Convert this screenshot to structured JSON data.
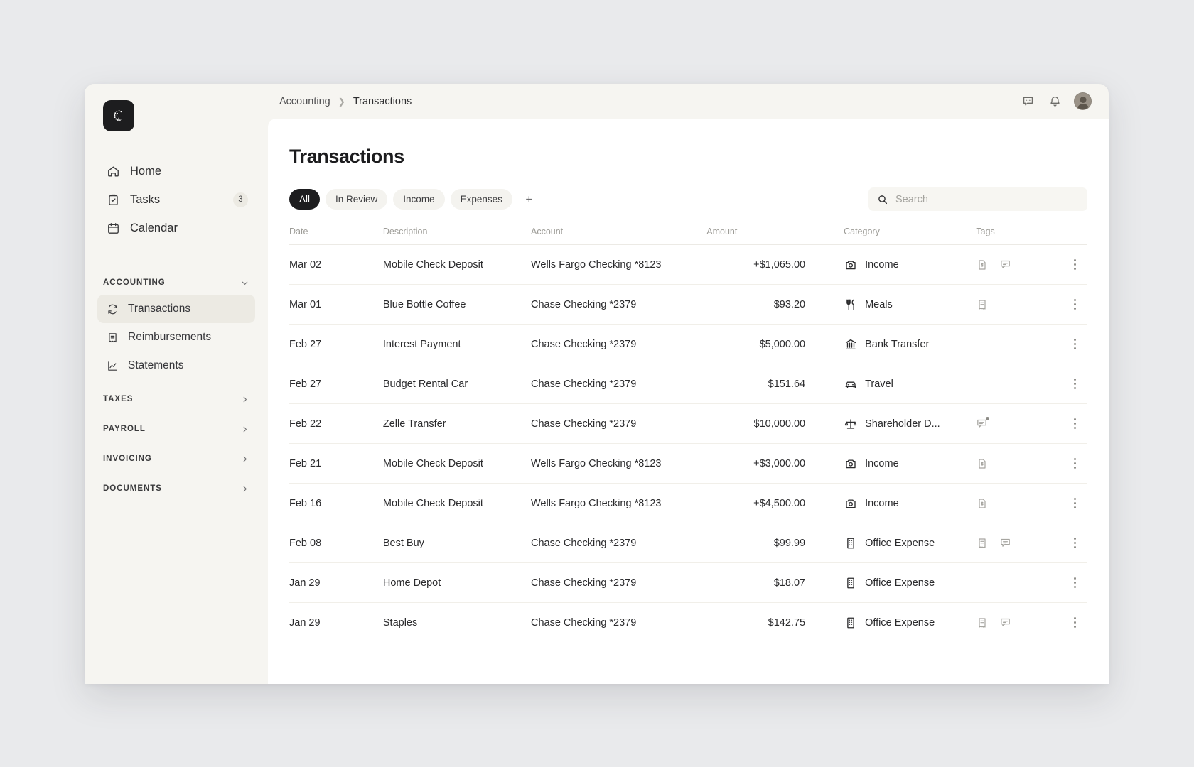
{
  "window": {
    "logo_name": "company-logo"
  },
  "sidebar": {
    "primary": [
      {
        "label": "Home",
        "icon": "home-icon",
        "badge": null
      },
      {
        "label": "Tasks",
        "icon": "clipboard-check-icon",
        "badge": "3"
      },
      {
        "label": "Calendar",
        "icon": "calendar-icon",
        "badge": null
      }
    ],
    "accounting": {
      "label": "ACCOUNTING",
      "expanded": true,
      "items": [
        {
          "label": "Transactions",
          "icon": "refresh-icon",
          "active": true
        },
        {
          "label": "Reimbursements",
          "icon": "receipt-icon",
          "active": false
        },
        {
          "label": "Statements",
          "icon": "chart-line-icon",
          "active": false
        }
      ]
    },
    "sections": [
      {
        "label": "TAXES"
      },
      {
        "label": "PAYROLL"
      },
      {
        "label": "INVOICING"
      },
      {
        "label": "DOCUMENTS"
      }
    ]
  },
  "topbar": {
    "breadcrumb": [
      "Accounting",
      "Transactions"
    ],
    "icons": [
      "chat-bubble-icon",
      "bell-icon"
    ],
    "avatar": "user-avatar"
  },
  "page": {
    "title": "Transactions",
    "filters": [
      {
        "label": "All",
        "active": true
      },
      {
        "label": "In Review",
        "active": false
      },
      {
        "label": "Income",
        "active": false
      },
      {
        "label": "Expenses",
        "active": false
      }
    ],
    "add_filter_label": "+",
    "search": {
      "placeholder": "Search",
      "value": ""
    }
  },
  "table": {
    "columns": [
      "Date",
      "Description",
      "Account",
      "Amount",
      "Category",
      "Tags"
    ],
    "rows": [
      {
        "date": "Mar 02",
        "description": "Mobile Check Deposit",
        "account": "Wells Fargo Checking *8123",
        "amount": "+$1,065.00",
        "positive": true,
        "category": "Income",
        "category_icon": "income-camera-icon",
        "tags": [
          "invoice-icon",
          "comment-icon"
        ]
      },
      {
        "date": "Mar 01",
        "description": "Blue Bottle Coffee",
        "account": "Chase Checking *2379",
        "amount": "$93.20",
        "positive": false,
        "category": "Meals",
        "category_icon": "utensils-icon",
        "tags": [
          "receipt-icon"
        ]
      },
      {
        "date": "Feb 27",
        "description": "Interest Payment",
        "account": "Chase Checking *2379",
        "amount": "$5,000.00",
        "positive": false,
        "category": "Bank Transfer",
        "category_icon": "bank-icon",
        "tags": []
      },
      {
        "date": "Feb 27",
        "description": "Budget Rental Car",
        "account": "Chase Checking *2379",
        "amount": "$151.64",
        "positive": false,
        "category": "Travel",
        "category_icon": "car-icon",
        "tags": []
      },
      {
        "date": "Feb 22",
        "description": "Zelle Transfer",
        "account": "Chase Checking *2379",
        "amount": "$10,000.00",
        "positive": false,
        "category": "Shareholder D...",
        "category_icon": "scales-icon",
        "tags": [
          "comment-badge-icon"
        ]
      },
      {
        "date": "Feb 21",
        "description": "Mobile Check Deposit",
        "account": "Wells Fargo Checking *8123",
        "amount": "+$3,000.00",
        "positive": true,
        "category": "Income",
        "category_icon": "income-camera-icon",
        "tags": [
          "invoice-icon"
        ]
      },
      {
        "date": "Feb 16",
        "description": "Mobile Check Deposit",
        "account": "Wells Fargo Checking *8123",
        "amount": "+$4,500.00",
        "positive": true,
        "category": "Income",
        "category_icon": "income-camera-icon",
        "tags": [
          "invoice-icon"
        ]
      },
      {
        "date": "Feb 08",
        "description": "Best Buy",
        "account": "Chase Checking *2379",
        "amount": "$99.99",
        "positive": false,
        "category": "Office Expense",
        "category_icon": "building-icon",
        "tags": [
          "receipt-icon",
          "comment-icon"
        ]
      },
      {
        "date": "Jan 29",
        "description": "Home Depot",
        "account": "Chase Checking *2379",
        "amount": "$18.07",
        "positive": false,
        "category": "Office Expense",
        "category_icon": "building-icon",
        "tags": []
      },
      {
        "date": "Jan 29",
        "description": "Staples",
        "account": "Chase Checking *2379",
        "amount": "$142.75",
        "positive": false,
        "category": "Office Expense",
        "category_icon": "building-icon",
        "tags": [
          "receipt-icon",
          "comment-icon"
        ]
      }
    ]
  },
  "colors": {
    "accent": "#1d1d1f",
    "surface": "#f6f5f1",
    "content": "#ffffff",
    "desktop": "#e9eaec"
  }
}
